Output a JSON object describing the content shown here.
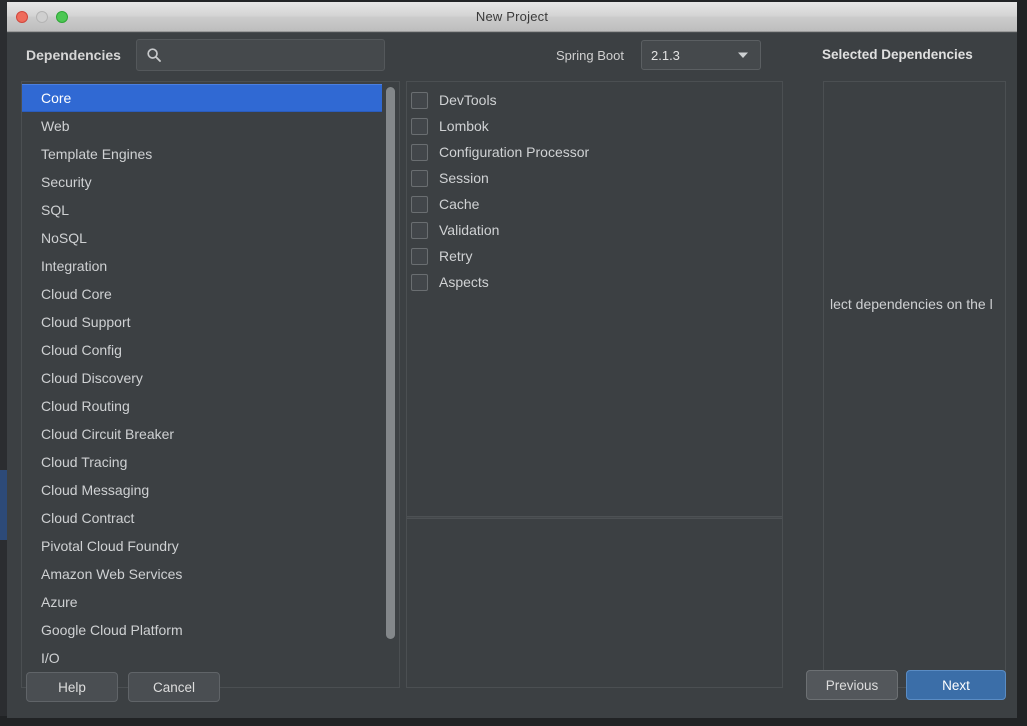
{
  "window": {
    "title": "New Project",
    "traffic_lights": [
      "close",
      "minimize",
      "zoom"
    ]
  },
  "header": {
    "dependencies_label": "Dependencies",
    "search": {
      "icon": "search-icon",
      "value": "",
      "placeholder": ""
    },
    "spring_boot_label": "Spring Boot",
    "version": {
      "selected": "2.1.3",
      "icon": "chevron-down-icon"
    },
    "selected_dependencies_label": "Selected Dependencies"
  },
  "categories": {
    "selected": "Core",
    "items": [
      {
        "label": "Core",
        "selected": true
      },
      {
        "label": "Web",
        "selected": false
      },
      {
        "label": "Template Engines",
        "selected": false
      },
      {
        "label": "Security",
        "selected": false
      },
      {
        "label": "SQL",
        "selected": false
      },
      {
        "label": "NoSQL",
        "selected": false
      },
      {
        "label": "Integration",
        "selected": false
      },
      {
        "label": "Cloud Core",
        "selected": false
      },
      {
        "label": "Cloud Support",
        "selected": false
      },
      {
        "label": "Cloud Config",
        "selected": false
      },
      {
        "label": "Cloud Discovery",
        "selected": false
      },
      {
        "label": "Cloud Routing",
        "selected": false
      },
      {
        "label": "Cloud Circuit Breaker",
        "selected": false
      },
      {
        "label": "Cloud Tracing",
        "selected": false
      },
      {
        "label": "Cloud Messaging",
        "selected": false
      },
      {
        "label": "Cloud Contract",
        "selected": false
      },
      {
        "label": "Pivotal Cloud Foundry",
        "selected": false
      },
      {
        "label": "Amazon Web Services",
        "selected": false
      },
      {
        "label": "Azure",
        "selected": false
      },
      {
        "label": "Google Cloud Platform",
        "selected": false
      },
      {
        "label": "I/O",
        "selected": false
      }
    ]
  },
  "modules": {
    "items": [
      {
        "label": "DevTools",
        "checked": false
      },
      {
        "label": "Lombok",
        "checked": false
      },
      {
        "label": "Configuration Processor",
        "checked": false
      },
      {
        "label": "Session",
        "checked": false
      },
      {
        "label": "Cache",
        "checked": false
      },
      {
        "label": "Validation",
        "checked": false
      },
      {
        "label": "Retry",
        "checked": false
      },
      {
        "label": "Aspects",
        "checked": false
      }
    ],
    "detail_text": ""
  },
  "selected_dependencies": {
    "empty_message": "lect dependencies on the l",
    "items": []
  },
  "footer": {
    "help_label": "Help",
    "cancel_label": "Cancel",
    "previous_label": "Previous",
    "next_label": "Next"
  },
  "colors": {
    "accent_selection": "#3069d3",
    "primary_button": "#3b6ea8",
    "panel_background": "#3c4043",
    "text": "#cfd1d3"
  }
}
